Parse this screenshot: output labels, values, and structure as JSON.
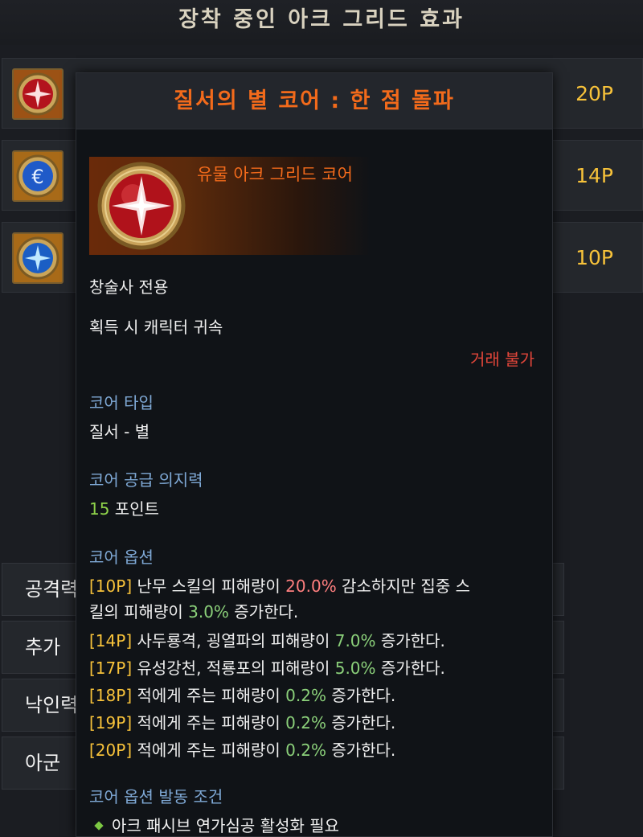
{
  "panel": {
    "title": "장착 중인 아크 그리드 효과",
    "cores": [
      {
        "points": "20P",
        "icon": "red-star-core-icon"
      },
      {
        "points": "14P",
        "icon": "blue-euro-core-icon"
      },
      {
        "points": "10P",
        "icon": "blue-star-core-icon"
      }
    ],
    "stats": [
      {
        "label": "공격력",
        "value": ""
      },
      {
        "label": "추가",
        "value": ""
      },
      {
        "label": "낙인력",
        "value": ""
      },
      {
        "label": "아군",
        "value": ""
      }
    ]
  },
  "tooltip": {
    "title": "질서의 별 코어 : 한 점 돌파",
    "grade": "유물 아크 그리드 코어",
    "class_restriction": "창술사 전용",
    "binding": "획득 시 캐릭터 귀속",
    "trade": "거래 불가",
    "core_type": {
      "label": "코어 타입",
      "value": "질서 - 별"
    },
    "willpower": {
      "label": "코어 공급 의지력",
      "value_num": "15",
      "value_unit": " 포인트"
    },
    "options": {
      "label": "코어 옵션",
      "lines": [
        {
          "tag": "[10P]",
          "a": " 난무 스킬의 피해량이 ",
          "n1": "20.0%",
          "b": " 감소하지만 집중 스",
          "c": "킬의 피해량이 ",
          "n2": "3.0%",
          "d": " 증가한다."
        },
        {
          "tag": "[14P]",
          "a": " 사두룡격, 굉열파의 피해량이 ",
          "n": "7.0%",
          "b": " 증가한다."
        },
        {
          "tag": "[17P]",
          "a": " 유성강천, 적룡포의 피해량이 ",
          "n": "5.0%",
          "b": " 증가한다."
        },
        {
          "tag": "[18P]",
          "a": " 적에게 주는 피해량이 ",
          "n": "0.2%",
          "b": " 증가한다."
        },
        {
          "tag": "[19P]",
          "a": " 적에게 주는 피해량이 ",
          "n": "0.2%",
          "b": " 증가한다."
        },
        {
          "tag": "[20P]",
          "a": " 적에게 주는 피해량이 ",
          "n": "0.2%",
          "b": " 증가한다."
        }
      ]
    },
    "activation": {
      "label": "코어 옵션 발동 조건",
      "condition": "아크 패시브 연가심공 활성화 필요"
    }
  },
  "colors": {
    "accent": "#f26a1b",
    "points": "#f7c23a",
    "section": "#7fa9d6",
    "trade": "#e3463a"
  }
}
